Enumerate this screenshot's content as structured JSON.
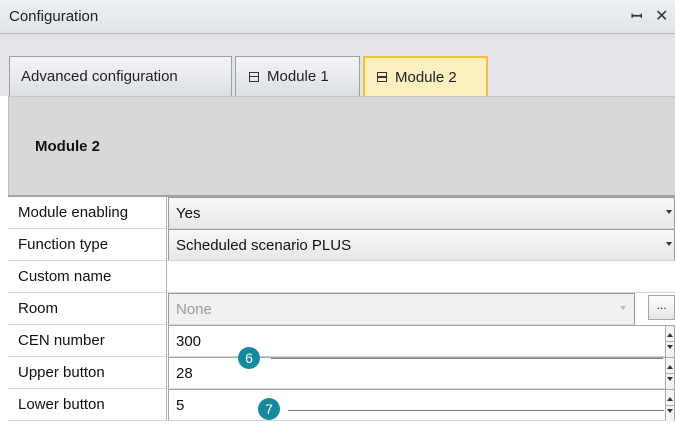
{
  "window": {
    "title": "Configuration",
    "pin_icon": "pin-icon",
    "close_icon": "close-icon"
  },
  "tabs": [
    {
      "label": "Advanced configuration",
      "active": false,
      "icon": null
    },
    {
      "label": "Module 1",
      "active": false,
      "icon": "module-icon"
    },
    {
      "label": "Module 2",
      "active": true,
      "icon": "module-icon"
    }
  ],
  "header": {
    "title": "Module 2"
  },
  "properties": {
    "module_enabling": {
      "label": "Module enabling",
      "value": "Yes"
    },
    "function_type": {
      "label": "Function type",
      "value": "Scheduled scenario PLUS"
    },
    "custom_name": {
      "label": "Custom name",
      "value": ""
    },
    "room": {
      "label": "Room",
      "value": "None",
      "button": "..."
    },
    "cen_number": {
      "label": "CEN number",
      "value": "300"
    },
    "upper_button": {
      "label": "Upper button",
      "value": "28"
    },
    "lower_button": {
      "label": "Lower button",
      "value": "5"
    }
  },
  "callouts": {
    "cen": "6",
    "buttons": "7"
  },
  "colors": {
    "active_tab_bg": "#fbf0bf",
    "active_tab_border": "#f2c23a",
    "callout": "#17899c"
  }
}
